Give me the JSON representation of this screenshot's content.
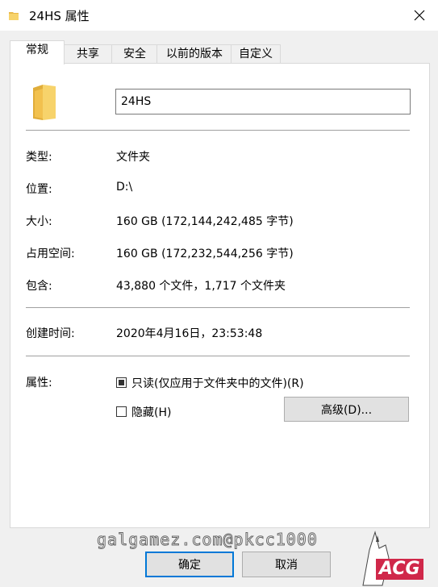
{
  "window": {
    "title": "24HS 属性",
    "close_icon": "close-icon",
    "title_icon": "folder-icon"
  },
  "tabs": [
    {
      "label": "常规",
      "active": true
    },
    {
      "label": "共享",
      "active": false
    },
    {
      "label": "安全",
      "active": false
    },
    {
      "label": "以前的版本",
      "active": false
    },
    {
      "label": "自定义",
      "active": false
    }
  ],
  "general": {
    "folder_name": "24HS",
    "type": {
      "label": "类型:",
      "value": "文件夹"
    },
    "location": {
      "label": "位置:",
      "value": "D:\\"
    },
    "size": {
      "label": "大小:",
      "value": "160 GB (172,144,242,485 字节)"
    },
    "size_on_disk": {
      "label": "占用空间:",
      "value": "160 GB (172,232,544,256 字节)"
    },
    "contains": {
      "label": "包含:",
      "value": "43,880 个文件，1,717 个文件夹"
    },
    "created": {
      "label": "创建时间:",
      "value": "2020年4月16日，23:53:48"
    },
    "attributes": {
      "label": "属性:",
      "readonly_label": "只读(仅应用于文件夹中的文件)(R)",
      "readonly_state": "indeterminate",
      "hidden_label": "隐藏(H)",
      "hidden_checked": false,
      "advanced_label": "高级(D)..."
    }
  },
  "footer": {
    "ok_label": "确定",
    "cancel_label": "取消"
  },
  "watermark": {
    "text": "galgamez.com@pkcc1000",
    "logo_text": "ACG"
  },
  "colors": {
    "accent": "#0078d7",
    "folder": "#f4c542",
    "watermark_logo": "#d0284a"
  }
}
